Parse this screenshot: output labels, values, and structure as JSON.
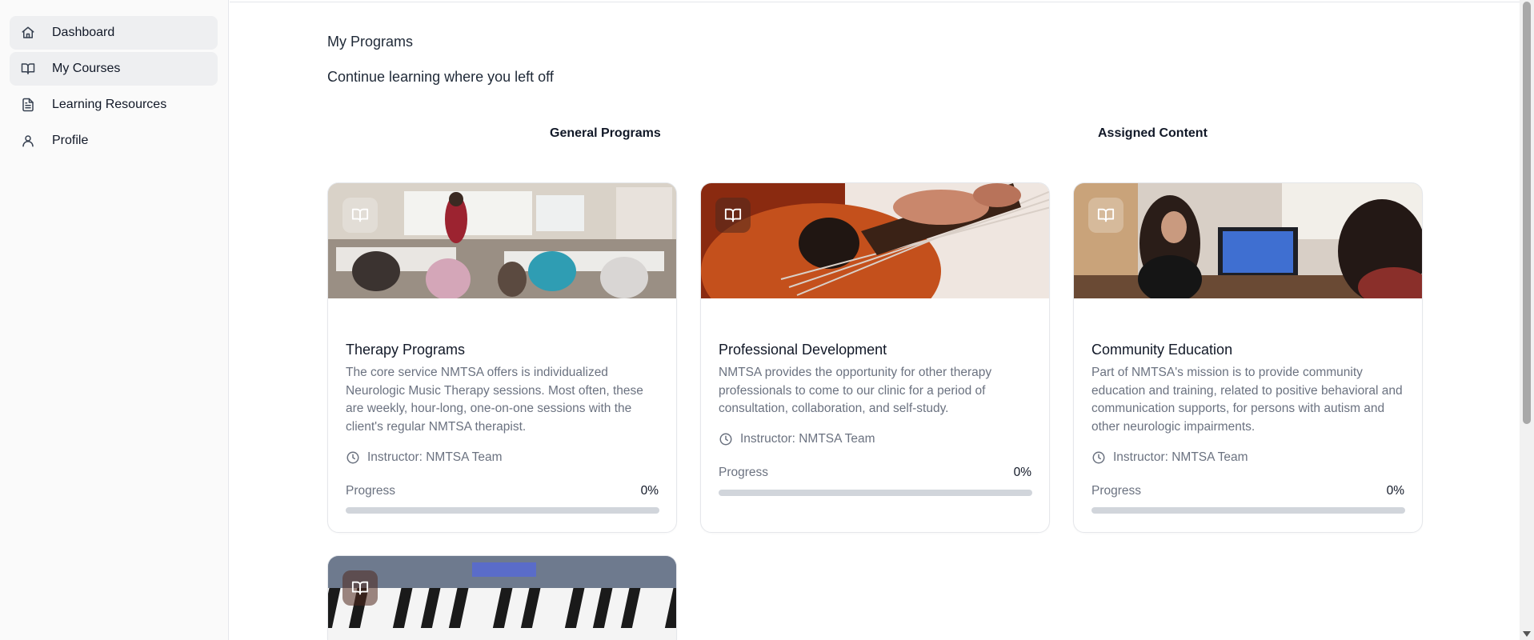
{
  "sidebar": {
    "items": [
      {
        "label": "Dashboard",
        "icon": "home-icon"
      },
      {
        "label": "My Courses",
        "icon": "book-open-icon"
      },
      {
        "label": "Learning Resources",
        "icon": "file-text-icon"
      },
      {
        "label": "Profile",
        "icon": "user-icon"
      }
    ]
  },
  "main": {
    "title": "My Programs",
    "subtitle": "Continue learning where you left off",
    "tabs": [
      {
        "label": "General Programs"
      },
      {
        "label": "Assigned Content"
      }
    ],
    "cards": [
      {
        "title": "Therapy Programs",
        "description": "The core service NMTSA offers is individualized Neurologic Music Therapy sessions. Most often, these are weekly, hour-long, one-on-one sessions with the client's regular NMTSA therapist.",
        "instructor": "Instructor: NMTSA Team",
        "progress_label": "Progress",
        "progress_text": "0%",
        "progress": 0
      },
      {
        "title": "Professional Development",
        "description": "NMTSA provides the opportunity for other therapy professionals to come to our clinic for a period of consultation, collaboration, and self-study.",
        "instructor": "Instructor: NMTSA Team",
        "progress_label": "Progress",
        "progress_text": "0%",
        "progress": 0
      },
      {
        "title": "Community Education",
        "description": "Part of NMTSA's mission is to provide community education and training, related to positive behavioral and communication supports, for persons with autism and other neurologic impairments.",
        "instructor": "Instructor: NMTSA Team",
        "progress_label": "Progress",
        "progress_text": "0%",
        "progress": 0
      }
    ]
  },
  "colors": {
    "active_nav_bg": "#eeeff1",
    "progress_track": "#d1d5db",
    "muted_text": "#6b7280"
  }
}
